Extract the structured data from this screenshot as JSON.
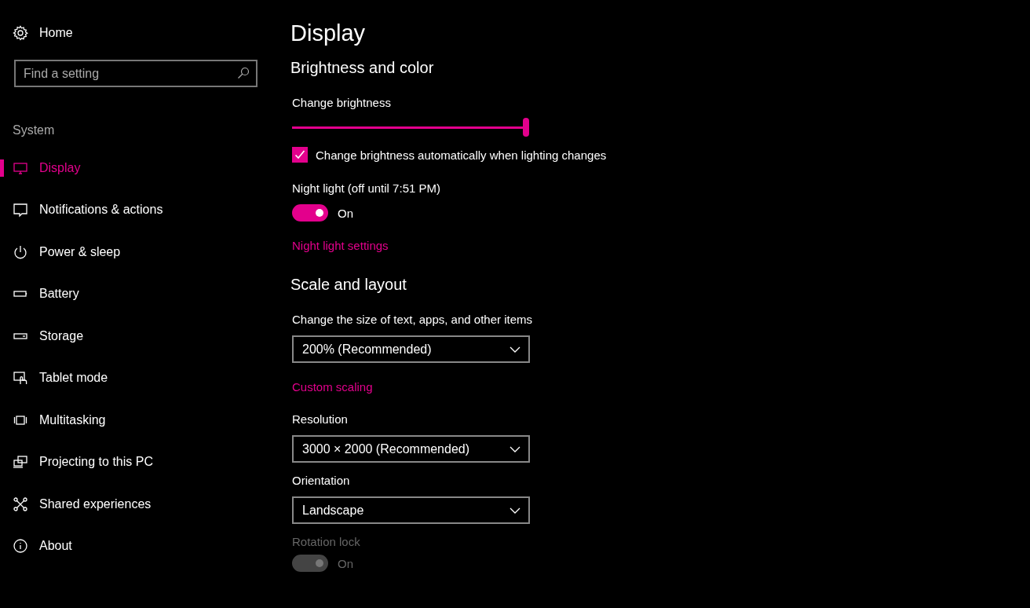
{
  "sidebar": {
    "home": "Home",
    "search": {
      "placeholder": "Find a setting"
    },
    "section": "System",
    "items": [
      {
        "label": "Display",
        "selected": true
      },
      {
        "label": "Notifications & actions",
        "selected": false
      },
      {
        "label": "Power & sleep",
        "selected": false
      },
      {
        "label": "Battery",
        "selected": false
      },
      {
        "label": "Storage",
        "selected": false
      },
      {
        "label": "Tablet mode",
        "selected": false
      },
      {
        "label": "Multitasking",
        "selected": false
      },
      {
        "label": "Projecting to this PC",
        "selected": false
      },
      {
        "label": "Shared experiences",
        "selected": false
      },
      {
        "label": "About",
        "selected": false
      }
    ]
  },
  "page": {
    "title": "Display",
    "items": [
      {
        "kind": "heading",
        "text": "Brightness and color"
      },
      {
        "kind": "label",
        "text": "Change brightness",
        "disabled": false
      },
      {
        "kind": "slider",
        "level": 1.0
      },
      {
        "kind": "checkbox",
        "text": "Change brightness automatically when lighting changes",
        "checked": true
      },
      {
        "kind": "label",
        "text": "Night light (off until 7:51 PM)",
        "disabled": false
      },
      {
        "kind": "toggle",
        "text": "On",
        "on": true,
        "disabled": false
      },
      {
        "kind": "link",
        "text": "Night light settings"
      },
      {
        "kind": "heading",
        "text": "Scale and layout"
      },
      {
        "kind": "label",
        "text": "Change the size of text, apps, and other items",
        "disabled": false
      },
      {
        "kind": "dropdown",
        "value": "200% (Recommended)"
      },
      {
        "kind": "link",
        "text": "Custom scaling"
      },
      {
        "kind": "label",
        "text": "Resolution",
        "disabled": false
      },
      {
        "kind": "dropdown",
        "value": "3000 × 2000 (Recommended)"
      },
      {
        "kind": "label",
        "text": "Orientation",
        "disabled": false
      },
      {
        "kind": "dropdown",
        "value": "Landscape"
      },
      {
        "kind": "label",
        "text": "Rotation lock",
        "disabled": true
      },
      {
        "kind": "toggle",
        "text": "On",
        "on": true,
        "disabled": true
      }
    ]
  }
}
